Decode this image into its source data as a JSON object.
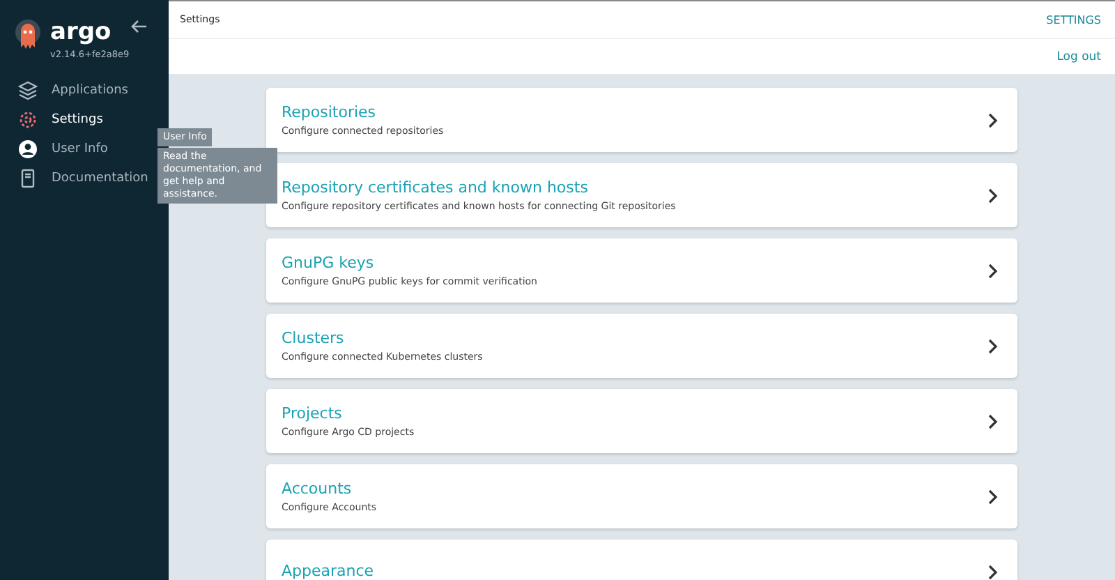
{
  "sidebar": {
    "logo": "argo",
    "version": "v2.14.6+fe2a8e9",
    "items": [
      {
        "label": "Applications",
        "selected": false
      },
      {
        "label": "Settings",
        "selected": true
      },
      {
        "label": "User Info",
        "selected": false
      },
      {
        "label": "Documentation",
        "selected": false
      }
    ],
    "tooltips": [
      "User Info",
      "Read the documentation, and get help and assistance."
    ]
  },
  "top_bar": {
    "title": "Settings",
    "tab": "SETTINGS",
    "action": "Log out"
  },
  "cards": [
    {
      "title": "Repositories",
      "description": "Configure connected repositories"
    },
    {
      "title": "Repository certificates and known hosts",
      "description": "Configure repository certificates and known hosts for connecting Git repositories"
    },
    {
      "title": "GnuPG keys",
      "description": "Configure GnuPG public keys for commit verification"
    },
    {
      "title": "Clusters",
      "description": "Configure connected Kubernetes clusters"
    },
    {
      "title": "Projects",
      "description": "Configure Argo CD projects"
    },
    {
      "title": "Accounts",
      "description": "Configure Accounts"
    },
    {
      "title": "Appearance"
    }
  ]
}
